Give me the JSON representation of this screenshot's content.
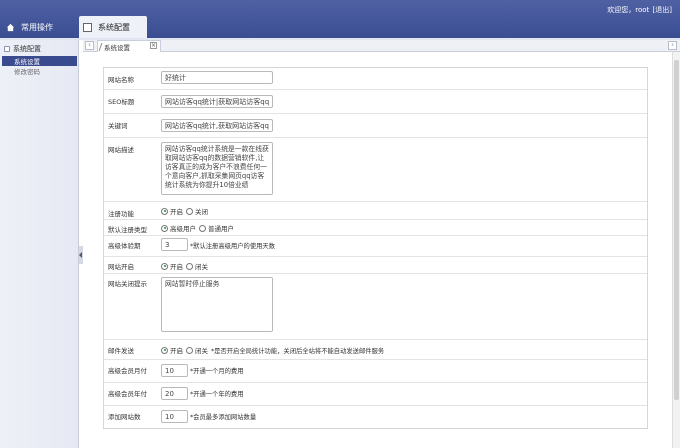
{
  "header": {
    "user_text": "欢迎您，root",
    "logout_text": "[退出]",
    "tab_common": "常用操作",
    "tab_system": "系统配置"
  },
  "sidebar": {
    "section": "系统配置",
    "items": [
      {
        "label": "系统设置",
        "active": true
      },
      {
        "label": "修改密码",
        "active": false
      }
    ]
  },
  "tabs": {
    "current": "系统设置",
    "close": "×"
  },
  "form": {
    "site_name": {
      "label": "网站名称",
      "value": "好统计"
    },
    "seo_title": {
      "label": "SEO标题",
      "value": "网站访客qq统计|获取网站访客qq"
    },
    "keywords": {
      "label": "关键词",
      "value": "网站访客qq统计,获取网站访客qq"
    },
    "description": {
      "label": "网站描述",
      "value": "网站访客qq统计系统是一款在线获取网站访客qq的数据营销软件,让访客真正的成为客户不浪费任何一个意向客户,抓取采集网页qq访客统计系统为你提升10倍业绩"
    },
    "register": {
      "label": "注册功能",
      "options": [
        "开启",
        "关闭"
      ],
      "selected": 0
    },
    "default_type": {
      "label": "默认注册类型",
      "options": [
        "高级用户",
        "普通用户"
      ],
      "selected": 0
    },
    "trial": {
      "label": "高级体验期",
      "value": "3",
      "hint": "*默认注册高级用户的使用天数"
    },
    "site_open": {
      "label": "网站开启",
      "options": [
        "开启",
        "闭关"
      ],
      "selected": 0
    },
    "close_msg": {
      "label": "网站关闭提示",
      "value": "网站暂时停止服务"
    },
    "mail": {
      "label": "邮件发送",
      "options": [
        "开启",
        "闭关"
      ],
      "selected": 0,
      "hint": "*是否开启全局统计功能，关闭后全站将不能自动发送邮件服务"
    },
    "monthly": {
      "label": "高级会员月付",
      "value": "10",
      "hint": "*开通一个月的费用"
    },
    "yearly": {
      "label": "高级会员年付",
      "value": "20",
      "hint": "*开通一个年的费用"
    },
    "add_site": {
      "label": "添加网站数",
      "value": "10",
      "hint": "*会员最多添加网站数量"
    }
  },
  "colors": {
    "header_bg": "#3b4e92",
    "active_item": "#3a4a8e",
    "radio_on": "#1e8e3e"
  }
}
